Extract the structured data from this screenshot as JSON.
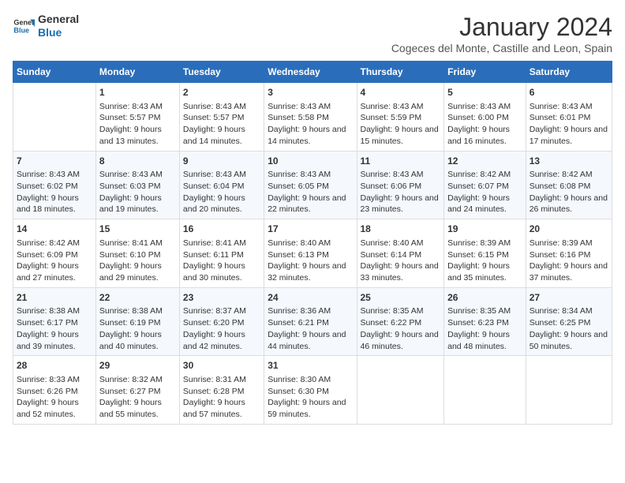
{
  "logo": {
    "line1": "General",
    "line2": "Blue"
  },
  "title": "January 2024",
  "location": "Cogeces del Monte, Castille and Leon, Spain",
  "headers": [
    "Sunday",
    "Monday",
    "Tuesday",
    "Wednesday",
    "Thursday",
    "Friday",
    "Saturday"
  ],
  "weeks": [
    [
      {
        "day": "",
        "sunrise": "",
        "sunset": "",
        "daylight": ""
      },
      {
        "day": "1",
        "sunrise": "Sunrise: 8:43 AM",
        "sunset": "Sunset: 5:57 PM",
        "daylight": "Daylight: 9 hours and 13 minutes."
      },
      {
        "day": "2",
        "sunrise": "Sunrise: 8:43 AM",
        "sunset": "Sunset: 5:57 PM",
        "daylight": "Daylight: 9 hours and 14 minutes."
      },
      {
        "day": "3",
        "sunrise": "Sunrise: 8:43 AM",
        "sunset": "Sunset: 5:58 PM",
        "daylight": "Daylight: 9 hours and 14 minutes."
      },
      {
        "day": "4",
        "sunrise": "Sunrise: 8:43 AM",
        "sunset": "Sunset: 5:59 PM",
        "daylight": "Daylight: 9 hours and 15 minutes."
      },
      {
        "day": "5",
        "sunrise": "Sunrise: 8:43 AM",
        "sunset": "Sunset: 6:00 PM",
        "daylight": "Daylight: 9 hours and 16 minutes."
      },
      {
        "day": "6",
        "sunrise": "Sunrise: 8:43 AM",
        "sunset": "Sunset: 6:01 PM",
        "daylight": "Daylight: 9 hours and 17 minutes."
      }
    ],
    [
      {
        "day": "7",
        "sunrise": "Sunrise: 8:43 AM",
        "sunset": "Sunset: 6:02 PM",
        "daylight": "Daylight: 9 hours and 18 minutes."
      },
      {
        "day": "8",
        "sunrise": "Sunrise: 8:43 AM",
        "sunset": "Sunset: 6:03 PM",
        "daylight": "Daylight: 9 hours and 19 minutes."
      },
      {
        "day": "9",
        "sunrise": "Sunrise: 8:43 AM",
        "sunset": "Sunset: 6:04 PM",
        "daylight": "Daylight: 9 hours and 20 minutes."
      },
      {
        "day": "10",
        "sunrise": "Sunrise: 8:43 AM",
        "sunset": "Sunset: 6:05 PM",
        "daylight": "Daylight: 9 hours and 22 minutes."
      },
      {
        "day": "11",
        "sunrise": "Sunrise: 8:43 AM",
        "sunset": "Sunset: 6:06 PM",
        "daylight": "Daylight: 9 hours and 23 minutes."
      },
      {
        "day": "12",
        "sunrise": "Sunrise: 8:42 AM",
        "sunset": "Sunset: 6:07 PM",
        "daylight": "Daylight: 9 hours and 24 minutes."
      },
      {
        "day": "13",
        "sunrise": "Sunrise: 8:42 AM",
        "sunset": "Sunset: 6:08 PM",
        "daylight": "Daylight: 9 hours and 26 minutes."
      }
    ],
    [
      {
        "day": "14",
        "sunrise": "Sunrise: 8:42 AM",
        "sunset": "Sunset: 6:09 PM",
        "daylight": "Daylight: 9 hours and 27 minutes."
      },
      {
        "day": "15",
        "sunrise": "Sunrise: 8:41 AM",
        "sunset": "Sunset: 6:10 PM",
        "daylight": "Daylight: 9 hours and 29 minutes."
      },
      {
        "day": "16",
        "sunrise": "Sunrise: 8:41 AM",
        "sunset": "Sunset: 6:11 PM",
        "daylight": "Daylight: 9 hours and 30 minutes."
      },
      {
        "day": "17",
        "sunrise": "Sunrise: 8:40 AM",
        "sunset": "Sunset: 6:13 PM",
        "daylight": "Daylight: 9 hours and 32 minutes."
      },
      {
        "day": "18",
        "sunrise": "Sunrise: 8:40 AM",
        "sunset": "Sunset: 6:14 PM",
        "daylight": "Daylight: 9 hours and 33 minutes."
      },
      {
        "day": "19",
        "sunrise": "Sunrise: 8:39 AM",
        "sunset": "Sunset: 6:15 PM",
        "daylight": "Daylight: 9 hours and 35 minutes."
      },
      {
        "day": "20",
        "sunrise": "Sunrise: 8:39 AM",
        "sunset": "Sunset: 6:16 PM",
        "daylight": "Daylight: 9 hours and 37 minutes."
      }
    ],
    [
      {
        "day": "21",
        "sunrise": "Sunrise: 8:38 AM",
        "sunset": "Sunset: 6:17 PM",
        "daylight": "Daylight: 9 hours and 39 minutes."
      },
      {
        "day": "22",
        "sunrise": "Sunrise: 8:38 AM",
        "sunset": "Sunset: 6:19 PM",
        "daylight": "Daylight: 9 hours and 40 minutes."
      },
      {
        "day": "23",
        "sunrise": "Sunrise: 8:37 AM",
        "sunset": "Sunset: 6:20 PM",
        "daylight": "Daylight: 9 hours and 42 minutes."
      },
      {
        "day": "24",
        "sunrise": "Sunrise: 8:36 AM",
        "sunset": "Sunset: 6:21 PM",
        "daylight": "Daylight: 9 hours and 44 minutes."
      },
      {
        "day": "25",
        "sunrise": "Sunrise: 8:35 AM",
        "sunset": "Sunset: 6:22 PM",
        "daylight": "Daylight: 9 hours and 46 minutes."
      },
      {
        "day": "26",
        "sunrise": "Sunrise: 8:35 AM",
        "sunset": "Sunset: 6:23 PM",
        "daylight": "Daylight: 9 hours and 48 minutes."
      },
      {
        "day": "27",
        "sunrise": "Sunrise: 8:34 AM",
        "sunset": "Sunset: 6:25 PM",
        "daylight": "Daylight: 9 hours and 50 minutes."
      }
    ],
    [
      {
        "day": "28",
        "sunrise": "Sunrise: 8:33 AM",
        "sunset": "Sunset: 6:26 PM",
        "daylight": "Daylight: 9 hours and 52 minutes."
      },
      {
        "day": "29",
        "sunrise": "Sunrise: 8:32 AM",
        "sunset": "Sunset: 6:27 PM",
        "daylight": "Daylight: 9 hours and 55 minutes."
      },
      {
        "day": "30",
        "sunrise": "Sunrise: 8:31 AM",
        "sunset": "Sunset: 6:28 PM",
        "daylight": "Daylight: 9 hours and 57 minutes."
      },
      {
        "day": "31",
        "sunrise": "Sunrise: 8:30 AM",
        "sunset": "Sunset: 6:30 PM",
        "daylight": "Daylight: 9 hours and 59 minutes."
      },
      {
        "day": "",
        "sunrise": "",
        "sunset": "",
        "daylight": ""
      },
      {
        "day": "",
        "sunrise": "",
        "sunset": "",
        "daylight": ""
      },
      {
        "day": "",
        "sunrise": "",
        "sunset": "",
        "daylight": ""
      }
    ]
  ]
}
